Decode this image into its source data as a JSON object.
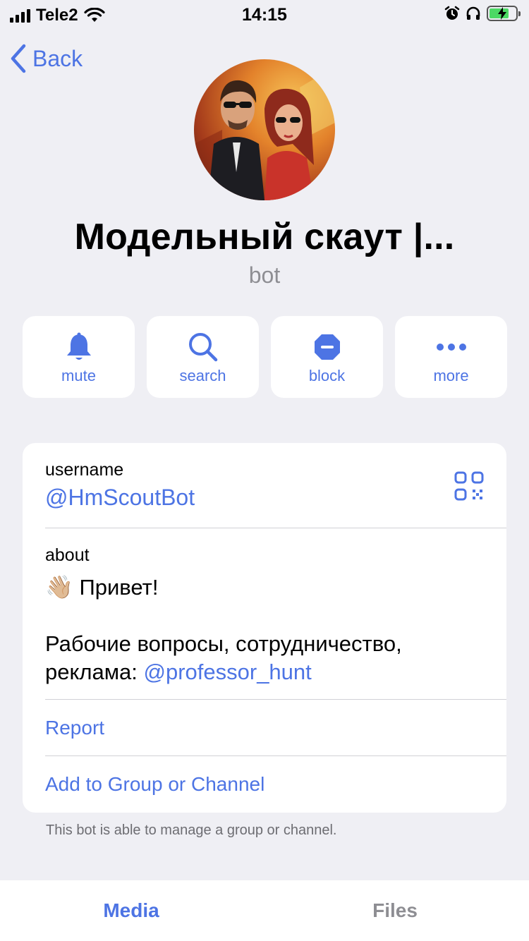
{
  "status_bar": {
    "carrier": "Tele2",
    "time": "14:15",
    "signal_bars": 4,
    "battery_level": 0.75,
    "icons": [
      "wifi-icon",
      "alarm-icon",
      "headphones-icon",
      "battery-charging-icon"
    ]
  },
  "nav": {
    "back_label": "Back"
  },
  "profile": {
    "name": "Модельный скаут |...",
    "subtitle": "bot"
  },
  "actions": [
    {
      "label": "mute",
      "icon": "bell-icon"
    },
    {
      "label": "search",
      "icon": "search-icon"
    },
    {
      "label": "block",
      "icon": "block-icon"
    },
    {
      "label": "more",
      "icon": "more-icon"
    }
  ],
  "info": {
    "username_label": "username",
    "username_value": "@HmScoutBot",
    "about_label": "about",
    "about_greeting": "Привет!",
    "about_line": "Рабочие вопросы, сотрудничество,",
    "about_prefix": "реклама: ",
    "about_link": "@professor_hunt",
    "report_label": "Report",
    "add_label": "Add to Group or Channel"
  },
  "footnote": "This bot is able to manage a group or channel.",
  "tabs": {
    "media": "Media",
    "files": "Files"
  },
  "colors": {
    "accent": "#4d74e4",
    "background": "#efeff4",
    "secondary": "#8e8e93"
  }
}
